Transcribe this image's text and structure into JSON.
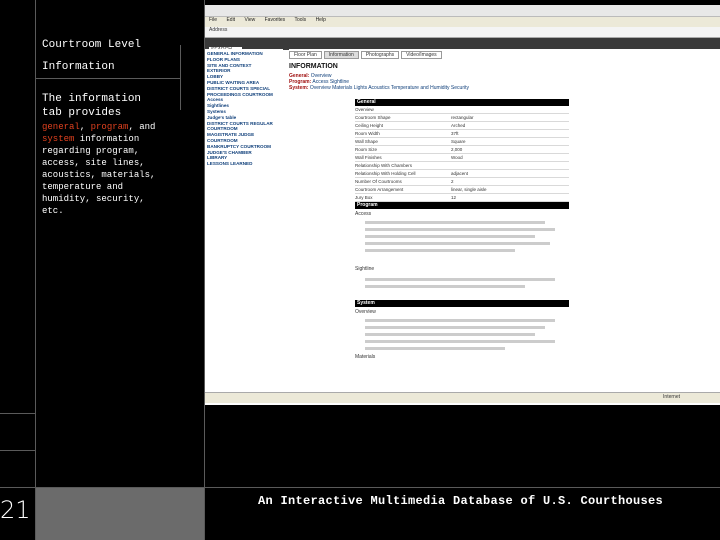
{
  "sidebar": {
    "heading_line1": "Courtroom Level",
    "heading_line2": "Information",
    "intro_line1": "The information",
    "intro_line2": "tab provides",
    "desc_general": "general",
    "desc_comma1": ",",
    "desc_program": "program",
    "desc_and": ", and",
    "desc_system": "system",
    "desc_rest1": " information",
    "desc_lines": [
      "regarding program,",
      "access, site lines,",
      "acoustics, materials,",
      "temperature and",
      "humidity, security,",
      "etc."
    ]
  },
  "footer": {
    "page_number": "21",
    "tagline": "An Interactive Multimedia Database of U.S. Courthouses"
  },
  "browser": {
    "menu": [
      "File",
      "Edit",
      "View",
      "Favorites",
      "Tools",
      "Help"
    ],
    "address_label": "Address",
    "search_label": "SEARCH",
    "tabs": [
      "Floor Plan",
      "Information",
      "Photographs",
      "Video/Images"
    ],
    "info_title": "INFORMATION",
    "general_label": "General:",
    "general_value": "Overview",
    "program_label": "Program:",
    "program_value": "Access  Sightline",
    "system_label": "System:",
    "system_value": "Overview  Materials  Lights  Acoustics  Temperature and Humidity  Security",
    "nav_items": [
      "GENERAL INFORMATION",
      "FLOOR PLANS",
      "SITE AND CONTEXT",
      "EXTERIOR",
      "LOBBY",
      "PUBLIC WAITING AREA",
      "DISTRICT COURTS SPECIAL",
      "PROCEEDINGS COURTROOM",
      "Access",
      "Sightlines",
      "Systems",
      "Judge's table",
      "DISTRICT COURTS REGULAR",
      "COURTROOM",
      "MAGISTRATE JUDGE",
      "COURTROOM",
      "BANKRUPTCY COURTROOM",
      "JUDGE'S CHAMBER",
      "LIBRARY",
      "LESSONS LEARNED"
    ],
    "table_header": "General",
    "rows": [
      [
        "Overview",
        ""
      ],
      [
        "Courtroom Shape",
        "rectangular"
      ],
      [
        "Ceiling Height",
        "Arched"
      ],
      [
        "Room Width",
        "37ft"
      ],
      [
        "Wall Shape",
        "Square"
      ],
      [
        "Room Size",
        "2,000"
      ],
      [
        "Wall Finishes",
        "Wood"
      ],
      [
        "Relationship With Chambers",
        ""
      ],
      [
        "Relationship With Holding Cell",
        "adjacent"
      ],
      [
        "Number Of Courtrooms",
        "2"
      ],
      [
        "Courtroom Arrangement",
        "linear, single aisle"
      ],
      [
        "Jury Box",
        "12"
      ]
    ],
    "program_header": "Program",
    "access_label": "Access",
    "sightline_label": "Sightline",
    "system_header": "System",
    "overview_label": "Overview",
    "materials_label": "Materials",
    "status_text": "Internet"
  }
}
